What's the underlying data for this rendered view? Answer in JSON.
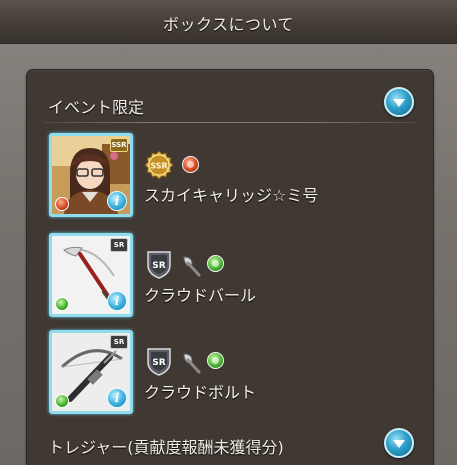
{
  "header": {
    "title": "ボックスについて"
  },
  "sections": [
    {
      "title": "イベント限定",
      "toggle_icon": "chevron-down-icon",
      "items": [
        {
          "name": "スカイキャリッジ☆ミ号",
          "type": "character",
          "rarity": "SSR",
          "element": "fire",
          "thumb_badge": "SSR"
        },
        {
          "name": "クラウドバール",
          "type": "weapon",
          "weapon_kind": "axe",
          "rarity": "SR",
          "element": "wind",
          "thumb_badge": "SR"
        },
        {
          "name": "クラウドボルト",
          "type": "weapon",
          "weapon_kind": "axe",
          "rarity": "SR",
          "element": "wind",
          "thumb_badge": "SR"
        }
      ]
    },
    {
      "title": "トレジャー(貢献度報酬未獲得分)",
      "toggle_icon": "chevron-down-icon"
    }
  ],
  "info_label": "i",
  "colors": {
    "panel_bg": "#3f3833",
    "accent_cyan": "#2e9fc9",
    "frame_cyan": "#8fdcef",
    "text": "#f4efe7",
    "fire": "#d0421c",
    "wind": "#3fae2a"
  }
}
